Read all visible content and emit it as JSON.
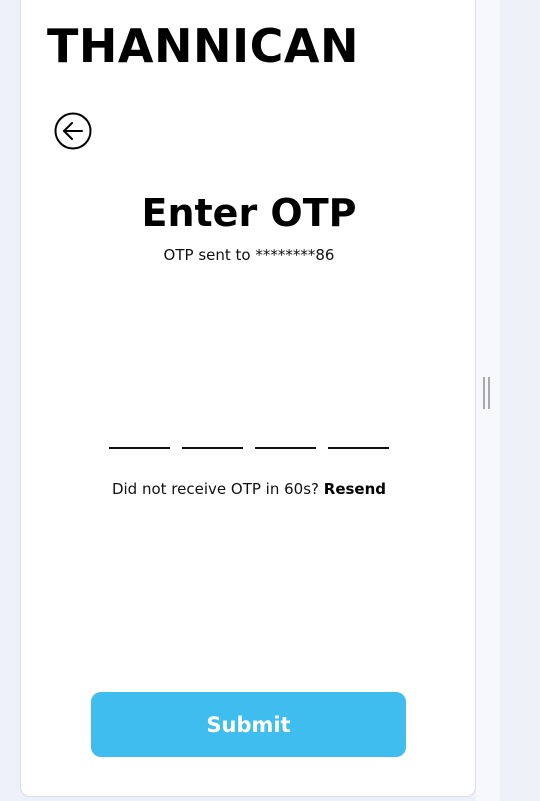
{
  "app": {
    "brand": "THANNICAN"
  },
  "otp_screen": {
    "title": "Enter OTP",
    "subtitle": "OTP sent to ********86",
    "digits": [
      "",
      "",
      "",
      ""
    ],
    "resend_prompt": "Did not receive OTP in 60s?",
    "resend_label": "Resend",
    "submit_label": "Submit"
  },
  "icons": {
    "back": "arrow-left-circle-icon",
    "resize": "resize-handle-icon"
  },
  "colors": {
    "page_background": "#edf0f8",
    "card_background": "#ffffff",
    "accent": "#3fbdef",
    "text": "#000000"
  }
}
